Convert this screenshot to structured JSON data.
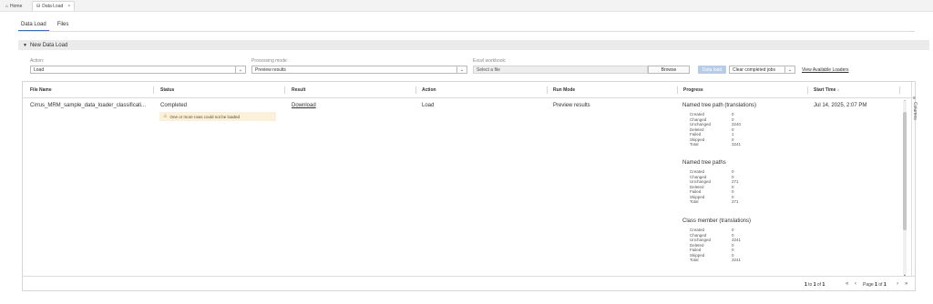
{
  "window_tabs": [
    {
      "label": "Home",
      "icon": "home-icon"
    },
    {
      "label": "Data Load",
      "icon": "database-icon",
      "close": "×"
    }
  ],
  "subtabs": [
    "Data Load",
    "Files"
  ],
  "panel": {
    "title": "New Data Load"
  },
  "form": {
    "action_label": "Action:",
    "action_value": "Load",
    "mode_label": "Processing mode:",
    "mode_value": "Preview results",
    "workbook_label": "Excel workbook:",
    "file_placeholder": "Select a file",
    "browse_label": "Browse",
    "data_load_label": "Data load",
    "clear_jobs_label": "Clear completed jobs",
    "view_loaders_label": "View Available Loaders"
  },
  "grid": {
    "columns": [
      "File Name",
      "Status",
      "Result",
      "Action",
      "Run Mode",
      "Progress",
      "Start Time"
    ],
    "sort_indicator": "↓",
    "row": {
      "file_name": "Cirrus_MRM_sample_data_loader_classificati...",
      "status": "Completed",
      "warning": "One or more rows could not be loaded",
      "result": "Download",
      "action": "Load",
      "run_mode": "Preview results",
      "start_time": "Jul 14, 2025, 2:07 PM",
      "progress": [
        {
          "title": "Named tree path (translations)",
          "stats": [
            {
              "label": "Created",
              "value": "0"
            },
            {
              "label": "Changed",
              "value": "0"
            },
            {
              "label": "Unchanged",
              "value": "3240"
            },
            {
              "label": "Deleted",
              "value": "0"
            },
            {
              "label": "Failed",
              "value": "1"
            },
            {
              "label": "Skipped",
              "value": "0"
            },
            {
              "label": "Total",
              "value": "3241"
            }
          ]
        },
        {
          "title": "Named tree paths",
          "stats": [
            {
              "label": "Created",
              "value": "0"
            },
            {
              "label": "Changed",
              "value": "0"
            },
            {
              "label": "Unchanged",
              "value": "271"
            },
            {
              "label": "Deleted",
              "value": "0"
            },
            {
              "label": "Failed",
              "value": "0"
            },
            {
              "label": "Skipped",
              "value": "0"
            },
            {
              "label": "Total",
              "value": "271"
            }
          ]
        },
        {
          "title": "Class member (translations)",
          "stats": [
            {
              "label": "Created",
              "value": "0"
            },
            {
              "label": "Changed",
              "value": "0"
            },
            {
              "label": "Unchanged",
              "value": "3241"
            },
            {
              "label": "Deleted",
              "value": "0"
            },
            {
              "label": "Failed",
              "value": "0"
            },
            {
              "label": "Skipped",
              "value": "0"
            },
            {
              "label": "Total",
              "value": "3241"
            }
          ]
        }
      ]
    },
    "columns_panel_label": "Columns",
    "footer": {
      "range_start": "1",
      "range_to": "to",
      "range_end": "1",
      "range_of": "of",
      "range_total": "1",
      "page_word": "Page",
      "page_current": "1",
      "page_of": "of",
      "page_total": "1"
    }
  }
}
